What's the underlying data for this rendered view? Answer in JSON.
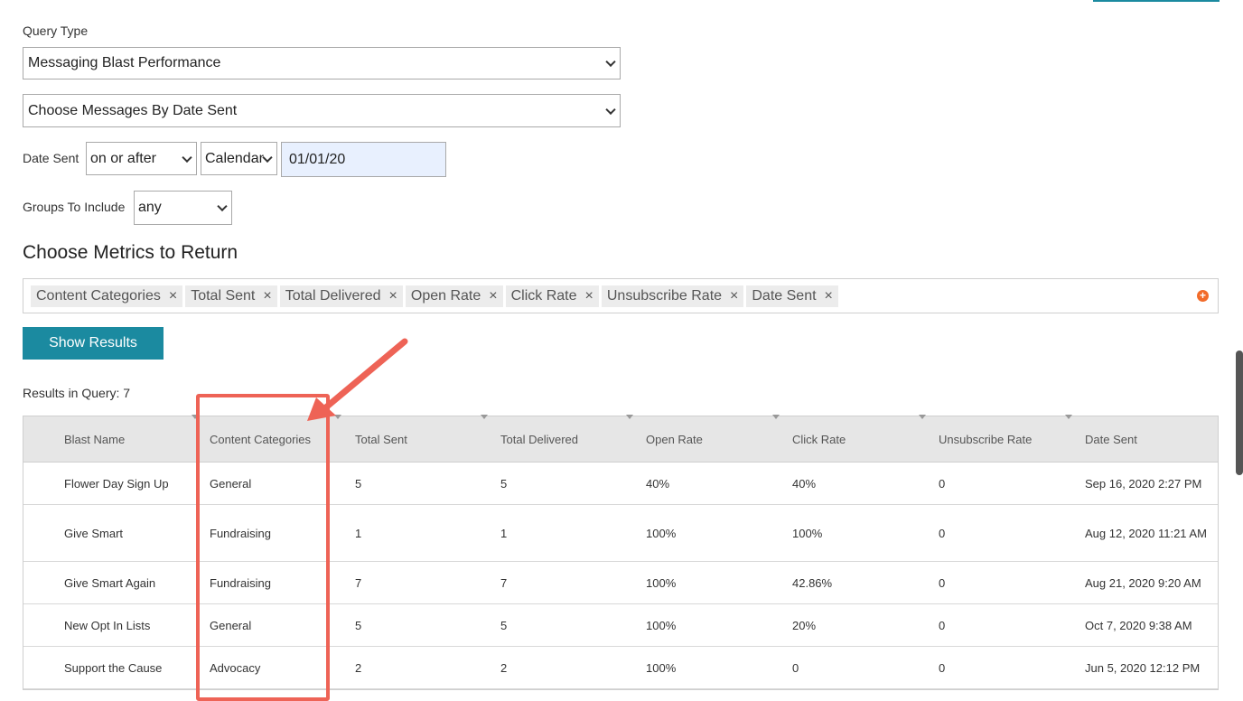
{
  "query_type": {
    "label": "Query Type",
    "selected": "Messaging Blast Performance"
  },
  "message_selection": {
    "selected": "Choose Messages By Date Sent"
  },
  "date_sent": {
    "label": "Date Sent",
    "operator": "on or after",
    "mode": "Calendar",
    "value": "01/01/20"
  },
  "groups": {
    "label": "Groups To Include",
    "selected": "any"
  },
  "metrics": {
    "title": "Choose Metrics to Return",
    "tags": [
      "Content Categories",
      "Total Sent",
      "Total Delivered",
      "Open Rate",
      "Click Rate",
      "Unsubscribe Rate",
      "Date Sent"
    ],
    "remove_glyph": "×",
    "add_glyph": "+"
  },
  "show_results_label": "Show Results",
  "results": {
    "count_label": "Results in Query: 7",
    "columns": [
      "Blast Name",
      "Content Categories",
      "Total Sent",
      "Total Delivered",
      "Open Rate",
      "Click Rate",
      "Unsubscribe Rate",
      "Date Sent"
    ],
    "rows": [
      [
        "Flower Day Sign Up",
        "General",
        "5",
        "5",
        "40%",
        "40%",
        "0",
        "Sep 16, 2020 2:27 PM"
      ],
      [
        "Give Smart",
        "Fundraising",
        "1",
        "1",
        "100%",
        "100%",
        "0",
        "Aug 12, 2020 11:21 AM"
      ],
      [
        "Give Smart Again",
        "Fundraising",
        "7",
        "7",
        "100%",
        "42.86%",
        "0",
        "Aug 21, 2020 9:20 AM"
      ],
      [
        "New Opt In Lists",
        "General",
        "5",
        "5",
        "100%",
        "20%",
        "0",
        "Oct 7, 2020 9:38 AM"
      ],
      [
        "Support the Cause",
        "Advocacy",
        "2",
        "2",
        "100%",
        "0",
        "0",
        "Jun 5, 2020 12:12 PM"
      ]
    ]
  },
  "colors": {
    "accent": "#1b8aa0",
    "annotation": "#ee6356",
    "add_icon": "#f26b2a"
  }
}
